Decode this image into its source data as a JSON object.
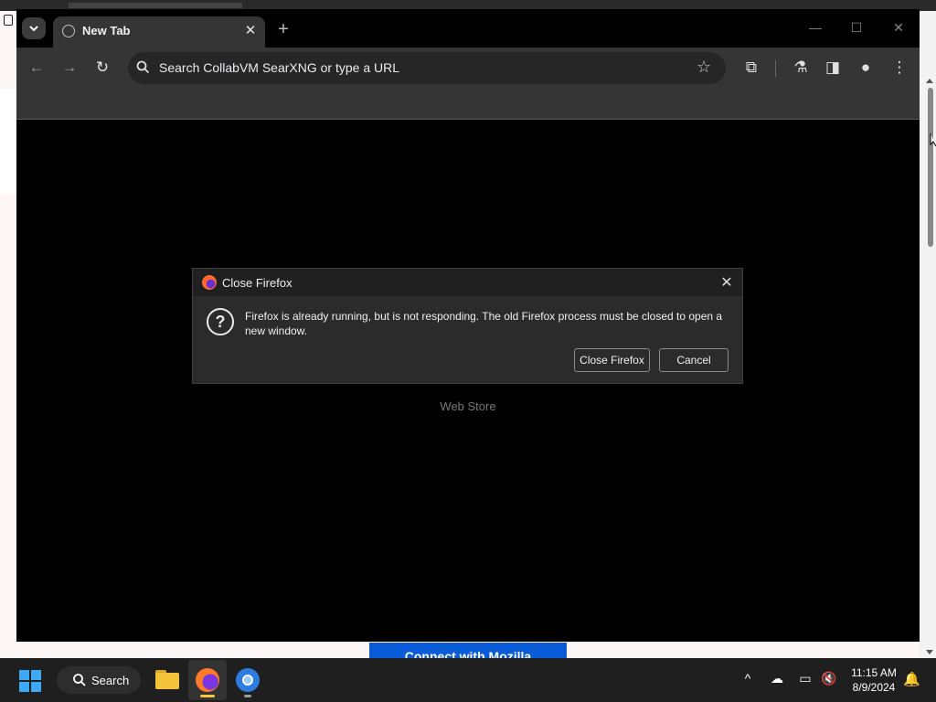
{
  "browser": {
    "tab_title": "New Tab",
    "address_placeholder": "Search CollabVM SearXNG or type a URL"
  },
  "page": {
    "shortcut_label": "Web Store",
    "banner_button": "Connect with Mozilla"
  },
  "dialog": {
    "title": "Close Firefox",
    "message": "Firefox is already running, but is not responding. The old Firefox process must be closed to open a new window.",
    "primary_button": "Close Firefox",
    "secondary_button": "Cancel"
  },
  "taskbar": {
    "search_label": "Search",
    "time": "11:15 AM",
    "date": "8/9/2024"
  },
  "colors": {
    "accent": "#0a5bd8",
    "windows_start": "#3da8f5"
  }
}
